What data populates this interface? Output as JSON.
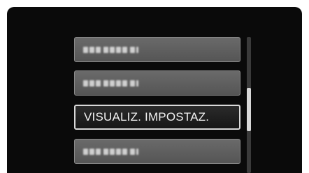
{
  "menu": {
    "items": [
      {
        "label": "",
        "obscured": true
      },
      {
        "label": "",
        "obscured": true
      },
      {
        "label": "VISUALIZ. IMPOSTAZ.",
        "obscured": false,
        "selected": true
      },
      {
        "label": "",
        "obscured": true
      }
    ]
  },
  "scroll": {
    "position_fraction": 0.55,
    "thumb_fraction": 0.32
  }
}
